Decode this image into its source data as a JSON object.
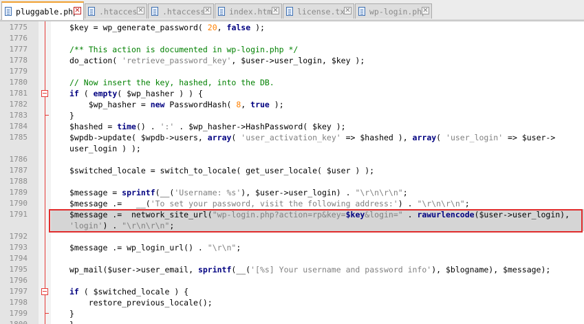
{
  "tabs": [
    {
      "label": "pluggable.php",
      "active": true
    },
    {
      "label": ".htaccess",
      "active": false
    },
    {
      "label": ".htaccess",
      "active": false
    },
    {
      "label": "index.html",
      "active": false
    },
    {
      "label": "license.txt",
      "active": false
    },
    {
      "label": "wp-login.php",
      "active": false
    }
  ],
  "close_glyph": "✕",
  "lines": [
    {
      "num": "1775",
      "tokens": [
        [
          "",
          "$key = wp_generate_password( "
        ],
        [
          "num",
          "20"
        ],
        [
          "",
          ", "
        ],
        [
          "kw",
          "false"
        ],
        [
          "",
          " );"
        ]
      ]
    },
    {
      "num": "1776",
      "tokens": []
    },
    {
      "num": "1777",
      "tokens": [
        [
          "cm",
          "/** This action is documented in wp-login.php */"
        ]
      ]
    },
    {
      "num": "1778",
      "tokens": [
        [
          "",
          "do_action( "
        ],
        [
          "str",
          "'retrieve_password_key'"
        ],
        [
          "",
          ", $user->user_login, $key );"
        ]
      ]
    },
    {
      "num": "1779",
      "tokens": []
    },
    {
      "num": "1780",
      "tokens": [
        [
          "cm",
          "// Now insert the key, hashed, into the DB."
        ]
      ]
    },
    {
      "num": "1781",
      "tokens": [
        [
          "kw",
          "if"
        ],
        [
          "",
          " ( "
        ],
        [
          "kw",
          "empty"
        ],
        [
          "",
          "( $wp_hasher ) ) {"
        ]
      ]
    },
    {
      "num": "1782",
      "tokens": [
        [
          "",
          "    $wp_hasher = "
        ],
        [
          "kw",
          "new"
        ],
        [
          "",
          " PasswordHash( "
        ],
        [
          "num",
          "8"
        ],
        [
          "",
          ", "
        ],
        [
          "kw",
          "true"
        ],
        [
          "",
          " );"
        ]
      ]
    },
    {
      "num": "1783",
      "tokens": [
        [
          "",
          "}"
        ]
      ]
    },
    {
      "num": "1784",
      "tokens": [
        [
          "",
          "$hashed = "
        ],
        [
          "kw",
          "time"
        ],
        [
          "",
          "() . "
        ],
        [
          "str",
          "':'"
        ],
        [
          "",
          " . $wp_hasher->HashPassword( $key );"
        ]
      ]
    },
    {
      "num": "1785",
      "tokens": [
        [
          "",
          "$wpdb->update( $wpdb->users, "
        ],
        [
          "kw",
          "array"
        ],
        [
          "",
          "( "
        ],
        [
          "str",
          "'user_activation_key'"
        ],
        [
          "",
          " => $hashed ), "
        ],
        [
          "kw",
          "array"
        ],
        [
          "",
          "( "
        ],
        [
          "str",
          "'user_login'"
        ],
        [
          "",
          " => $user->"
        ]
      ]
    },
    {
      "num": "",
      "tokens": [
        [
          "",
          "user_login ) );"
        ]
      ]
    },
    {
      "num": "1786",
      "tokens": []
    },
    {
      "num": "1787",
      "tokens": [
        [
          "",
          "$switched_locale = switch_to_locale( get_user_locale( $user ) );"
        ]
      ]
    },
    {
      "num": "1788",
      "tokens": []
    },
    {
      "num": "1789",
      "tokens": [
        [
          "",
          "$message = "
        ],
        [
          "kw",
          "sprintf"
        ],
        [
          "",
          "(__("
        ],
        [
          "str",
          "'Username: %s'"
        ],
        [
          "",
          "), $user->user_login) . "
        ],
        [
          "str",
          "\"\\r\\n\\r\\n\""
        ],
        [
          "",
          ";"
        ]
      ]
    },
    {
      "num": "1790",
      "tokens": [
        [
          "",
          "$message .=   __("
        ],
        [
          "str",
          "'To set your password, visit the following address:'"
        ],
        [
          "",
          ") . "
        ],
        [
          "str",
          "\"\\r\\n\\r\\n\""
        ],
        [
          "",
          ";"
        ]
      ]
    },
    {
      "num": "1791",
      "tokens": [
        [
          "",
          "$message .=  network_site_url("
        ],
        [
          "str",
          "\"wp-login.php?action=rp&key="
        ],
        [
          "kw",
          "$key"
        ],
        [
          "str",
          "&login=\""
        ],
        [
          "",
          " . "
        ],
        [
          "kw",
          "rawurlencode"
        ],
        [
          "",
          "($user->user_login),"
        ]
      ]
    },
    {
      "num": "",
      "tokens": [
        [
          "str",
          "'login'"
        ],
        [
          "",
          ") . "
        ],
        [
          "str",
          "\"\\r\\n\\r\\n\""
        ],
        [
          "",
          ";"
        ]
      ]
    },
    {
      "num": "1792",
      "tokens": []
    },
    {
      "num": "1793",
      "tokens": [
        [
          "",
          "$message .= wp_login_url() . "
        ],
        [
          "str",
          "\"\\r\\n\""
        ],
        [
          "",
          ";"
        ]
      ]
    },
    {
      "num": "1794",
      "tokens": []
    },
    {
      "num": "1795",
      "tokens": [
        [
          "",
          "wp_mail($user->user_email, "
        ],
        [
          "kw",
          "sprintf"
        ],
        [
          "",
          "(__("
        ],
        [
          "str",
          "'[%s] Your username and password info'"
        ],
        [
          "",
          "), $blogname), $message);"
        ]
      ]
    },
    {
      "num": "1796",
      "tokens": []
    },
    {
      "num": "1797",
      "tokens": [
        [
          "kw",
          "if"
        ],
        [
          "",
          " ( $switched_locale ) {"
        ]
      ]
    },
    {
      "num": "1798",
      "tokens": [
        [
          "",
          "    restore_previous_locale();"
        ]
      ]
    },
    {
      "num": "1799",
      "tokens": [
        [
          "",
          "}"
        ]
      ]
    },
    {
      "num": "1800",
      "tokens": [
        [
          "",
          "}"
        ]
      ]
    }
  ]
}
